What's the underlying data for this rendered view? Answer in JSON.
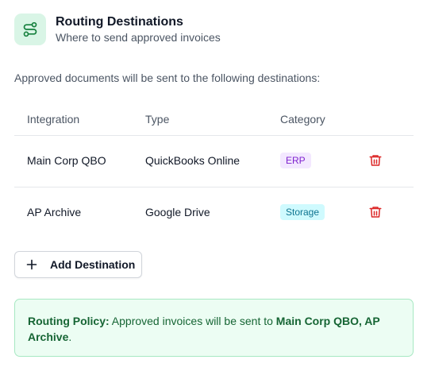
{
  "header": {
    "icon": "route-icon",
    "title": "Routing Destinations",
    "subtitle": "Where to send approved invoices"
  },
  "intro_text": "Approved documents will be sent to the following destinations:",
  "table": {
    "columns": [
      "Integration",
      "Type",
      "Category"
    ],
    "rows": [
      {
        "integration": "Main Corp QBO",
        "type": "QuickBooks Online",
        "category": "ERP",
        "action_icon": "trash-icon"
      },
      {
        "integration": "AP Archive",
        "type": "Google Drive",
        "category": "Storage",
        "action_icon": "trash-icon"
      }
    ]
  },
  "add_button": {
    "icon": "plus-icon",
    "label": "Add Destination"
  },
  "policy": {
    "label": "Routing Policy:",
    "text": " Approved invoices will be sent to ",
    "destinations": "Main Corp QBO, AP Archive",
    "end": "."
  },
  "colors": {
    "accent_green": "#166534",
    "icon_bg": "#d9f5e6",
    "erp_badge": "#7e22ce",
    "storage_badge": "#0e7490",
    "delete_red": "#dc2626"
  }
}
